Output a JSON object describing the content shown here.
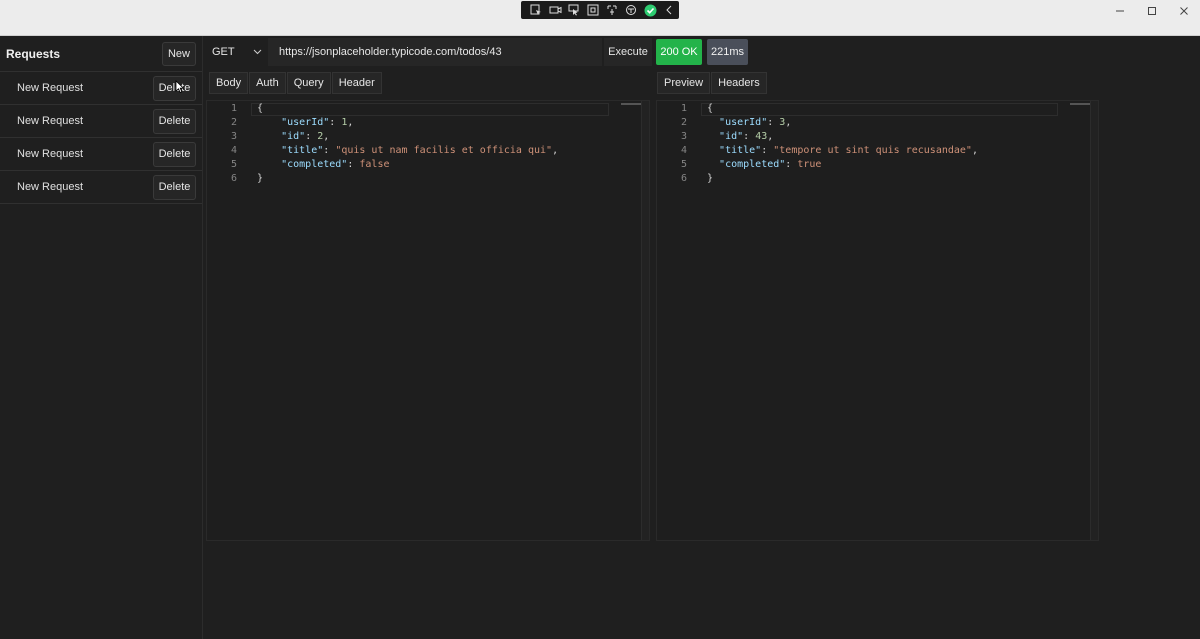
{
  "window": {
    "devtools_icons": [
      "inspect-icon",
      "camera-icon",
      "select-element-icon",
      "layout-icon",
      "touch-icon",
      "accessibility-icon",
      "check-icon",
      "collapse-icon"
    ],
    "controls": [
      "minimize-icon",
      "maximize-icon",
      "close-icon"
    ]
  },
  "sidebar": {
    "title": "Requests",
    "new_label": "New",
    "items": [
      {
        "label": "New Request",
        "delete_label": "Delete"
      },
      {
        "label": "New Request",
        "delete_label": "Delete"
      },
      {
        "label": "New Request",
        "delete_label": "Delete"
      },
      {
        "label": "New Request",
        "delete_label": "Delete"
      }
    ]
  },
  "request": {
    "method": "GET",
    "url": "https://jsonplaceholder.typicode.com/todos/43",
    "execute_label": "Execute",
    "tabs": [
      "Body",
      "Auth",
      "Query",
      "Header"
    ],
    "body_lines": [
      {
        "n": "1",
        "text": "{"
      },
      {
        "n": "2",
        "text": "    \"userId\": 1,"
      },
      {
        "n": "3",
        "text": "    \"id\": 2,"
      },
      {
        "n": "4",
        "text": "    \"title\": \"quis ut nam facilis et officia qui\","
      },
      {
        "n": "5",
        "text": "    \"completed\": false"
      },
      {
        "n": "6",
        "text": "}"
      }
    ]
  },
  "response": {
    "status": "200 OK",
    "time": "221ms",
    "tabs": [
      "Preview",
      "Headers"
    ],
    "body_lines": [
      {
        "n": "1",
        "text": "{"
      },
      {
        "n": "2",
        "text": "  \"userId\": 3,"
      },
      {
        "n": "3",
        "text": "  \"id\": 43,"
      },
      {
        "n": "4",
        "text": "  \"title\": \"tempore ut sint quis recusandae\","
      },
      {
        "n": "5",
        "text": "  \"completed\": true"
      },
      {
        "n": "6",
        "text": "}"
      }
    ]
  },
  "colors": {
    "status_ok": "#23b34a",
    "time_badge": "#4a4f5a",
    "json_key": "#9cdcfe",
    "json_string": "#ce9178",
    "json_number": "#b5cea8"
  }
}
